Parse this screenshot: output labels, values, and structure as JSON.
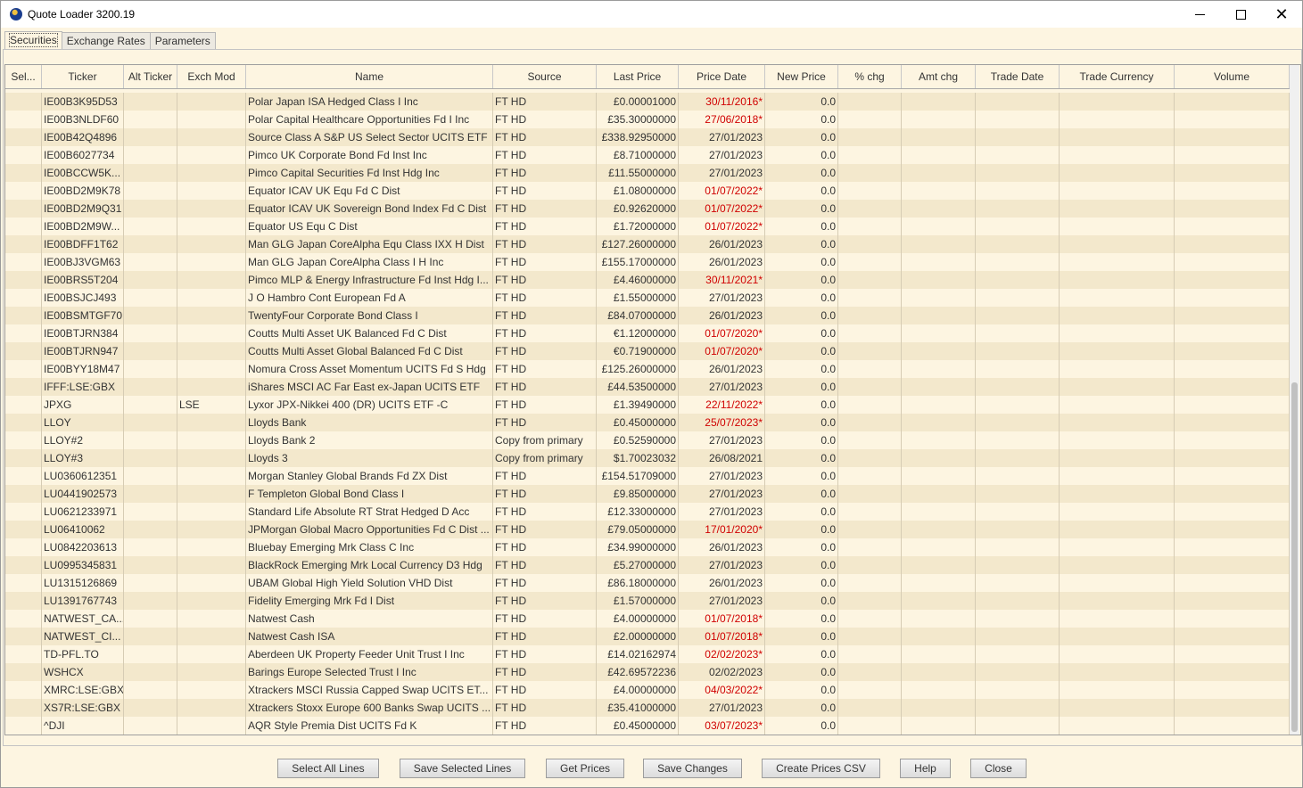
{
  "window": {
    "title": "Quote Loader 3200.19"
  },
  "tabs": [
    {
      "label": "Securities",
      "active": true
    },
    {
      "label": "Exchange Rates",
      "active": false
    },
    {
      "label": "Parameters",
      "active": false
    }
  ],
  "table": {
    "columns": [
      "Sel...",
      "Ticker",
      "Alt Ticker",
      "Exch Mod",
      "Name",
      "Source",
      "Last Price",
      "Price Date",
      "New Price",
      "% chg",
      "Amt chg",
      "Trade Date",
      "Trade Currency",
      "Volume"
    ],
    "rows": [
      {
        "ticker": "IE00B3K95D53",
        "alt": "",
        "exch": "",
        "name": "Polar Japan ISA Hedged Class I Inc",
        "source": "FT HD",
        "last_price": "£0.00001000",
        "price_date": "30/11/2016*",
        "stale": true,
        "new_price": "0.0"
      },
      {
        "ticker": "IE00B3NLDF60",
        "alt": "",
        "exch": "",
        "name": "Polar Capital Healthcare Opportunities Fd I Inc",
        "source": "FT HD",
        "last_price": "£35.30000000",
        "price_date": "27/06/2018*",
        "stale": true,
        "new_price": "0.0"
      },
      {
        "ticker": "IE00B42Q4896",
        "alt": "",
        "exch": "",
        "name": "Source Class A S&P US Select Sector UCITS ETF",
        "source": "FT HD",
        "last_price": "£338.92950000",
        "price_date": "27/01/2023",
        "stale": false,
        "new_price": "0.0"
      },
      {
        "ticker": "IE00B6027734",
        "alt": "",
        "exch": "",
        "name": "Pimco UK Corporate Bond Fd Inst Inc",
        "source": "FT HD",
        "last_price": "£8.71000000",
        "price_date": "27/01/2023",
        "stale": false,
        "new_price": "0.0"
      },
      {
        "ticker": "IE00BCCW5K...",
        "alt": "",
        "exch": "",
        "name": "Pimco Capital Securities Fd Inst Hdg Inc",
        "source": "FT HD",
        "last_price": "£11.55000000",
        "price_date": "27/01/2023",
        "stale": false,
        "new_price": "0.0"
      },
      {
        "ticker": "IE00BD2M9K78",
        "alt": "",
        "exch": "",
        "name": "Equator ICAV UK Equ Fd C Dist",
        "source": "FT HD",
        "last_price": "£1.08000000",
        "price_date": "01/07/2022*",
        "stale": true,
        "new_price": "0.0"
      },
      {
        "ticker": "IE00BD2M9Q31",
        "alt": "",
        "exch": "",
        "name": "Equator ICAV UK Sovereign Bond Index Fd C Dist",
        "source": "FT HD",
        "last_price": "£0.92620000",
        "price_date": "01/07/2022*",
        "stale": true,
        "new_price": "0.0"
      },
      {
        "ticker": "IE00BD2M9W...",
        "alt": "",
        "exch": "",
        "name": "Equator US Equ C Dist",
        "source": "FT HD",
        "last_price": "£1.72000000",
        "price_date": "01/07/2022*",
        "stale": true,
        "new_price": "0.0"
      },
      {
        "ticker": "IE00BDFF1T62",
        "alt": "",
        "exch": "",
        "name": "Man GLG Japan CoreAlpha Equ Class IXX H Dist",
        "source": "FT HD",
        "last_price": "£127.26000000",
        "price_date": "26/01/2023",
        "stale": false,
        "new_price": "0.0"
      },
      {
        "ticker": "IE00BJ3VGM63",
        "alt": "",
        "exch": "",
        "name": "Man GLG Japan CoreAlpha Class I H Inc",
        "source": "FT HD",
        "last_price": "£155.17000000",
        "price_date": "26/01/2023",
        "stale": false,
        "new_price": "0.0"
      },
      {
        "ticker": "IE00BRS5T204",
        "alt": "",
        "exch": "",
        "name": "Pimco MLP & Energy Infrastructure Fd Inst Hdg I...",
        "source": "FT HD",
        "last_price": "£4.46000000",
        "price_date": "30/11/2021*",
        "stale": true,
        "new_price": "0.0"
      },
      {
        "ticker": "IE00BSJCJ493",
        "alt": "",
        "exch": "",
        "name": "J O Hambro Cont European Fd A",
        "source": "FT HD",
        "last_price": "£1.55000000",
        "price_date": "27/01/2023",
        "stale": false,
        "new_price": "0.0"
      },
      {
        "ticker": "IE00BSMTGF70",
        "alt": "",
        "exch": "",
        "name": "TwentyFour Corporate Bond Class I",
        "source": "FT HD",
        "last_price": "£84.07000000",
        "price_date": "26/01/2023",
        "stale": false,
        "new_price": "0.0"
      },
      {
        "ticker": "IE00BTJRN384",
        "alt": "",
        "exch": "",
        "name": "Coutts Multi Asset UK Balanced Fd C Dist",
        "source": "FT HD",
        "last_price": "€1.12000000",
        "price_date": "01/07/2020*",
        "stale": true,
        "new_price": "0.0"
      },
      {
        "ticker": "IE00BTJRN947",
        "alt": "",
        "exch": "",
        "name": "Coutts Multi Asset Global Balanced Fd C Dist",
        "source": "FT HD",
        "last_price": "€0.71900000",
        "price_date": "01/07/2020*",
        "stale": true,
        "new_price": "0.0"
      },
      {
        "ticker": "IE00BYY18M47",
        "alt": "",
        "exch": "",
        "name": "Nomura Cross Asset Momentum UCITS Fd S Hdg",
        "source": "FT HD",
        "last_price": "£125.26000000",
        "price_date": "26/01/2023",
        "stale": false,
        "new_price": "0.0"
      },
      {
        "ticker": "IFFF:LSE:GBX",
        "alt": "",
        "exch": "",
        "name": "iShares MSCI AC Far East ex-Japan UCITS ETF",
        "source": "FT HD",
        "last_price": "£44.53500000",
        "price_date": "27/01/2023",
        "stale": false,
        "new_price": "0.0"
      },
      {
        "ticker": "JPXG",
        "alt": "",
        "exch": "LSE",
        "name": "Lyxor JPX-Nikkei 400 (DR) UCITS ETF -C",
        "source": "FT HD",
        "last_price": "£1.39490000",
        "price_date": "22/11/2022*",
        "stale": true,
        "new_price": "0.0"
      },
      {
        "ticker": "LLOY",
        "alt": "",
        "exch": "",
        "name": "Lloyds Bank",
        "source": "FT HD",
        "last_price": "£0.45000000",
        "price_date": "25/07/2023*",
        "stale": true,
        "new_price": "0.0"
      },
      {
        "ticker": "LLOY#2",
        "alt": "",
        "exch": "",
        "name": "Lloyds Bank 2",
        "source": "Copy from primary",
        "last_price": "£0.52590000",
        "price_date": "27/01/2023",
        "stale": false,
        "new_price": "0.0"
      },
      {
        "ticker": "LLOY#3",
        "alt": "",
        "exch": "",
        "name": "Lloyds 3",
        "source": "Copy from primary",
        "last_price": "$1.70023032",
        "price_date": "26/08/2021",
        "stale": false,
        "new_price": "0.0"
      },
      {
        "ticker": "LU0360612351",
        "alt": "",
        "exch": "",
        "name": "Morgan Stanley Global Brands Fd ZX Dist",
        "source": "FT HD",
        "last_price": "£154.51709000",
        "price_date": "27/01/2023",
        "stale": false,
        "new_price": "0.0"
      },
      {
        "ticker": "LU0441902573",
        "alt": "",
        "exch": "",
        "name": "F Templeton Global Bond Class I",
        "source": "FT HD",
        "last_price": "£9.85000000",
        "price_date": "27/01/2023",
        "stale": false,
        "new_price": "0.0"
      },
      {
        "ticker": "LU0621233971",
        "alt": "",
        "exch": "",
        "name": "Standard Life Absolute RT Strat Hedged D Acc",
        "source": "FT HD",
        "last_price": "£12.33000000",
        "price_date": "27/01/2023",
        "stale": false,
        "new_price": "0.0"
      },
      {
        "ticker": "LU06410062",
        "alt": "",
        "exch": "",
        "name": "JPMorgan Global Macro Opportunities Fd C Dist ...",
        "source": "FT HD",
        "last_price": "£79.05000000",
        "price_date": "17/01/2020*",
        "stale": true,
        "new_price": "0.0"
      },
      {
        "ticker": "LU0842203613",
        "alt": "",
        "exch": "",
        "name": "Bluebay Emerging Mrk Class C Inc",
        "source": "FT HD",
        "last_price": "£34.99000000",
        "price_date": "26/01/2023",
        "stale": false,
        "new_price": "0.0"
      },
      {
        "ticker": "LU0995345831",
        "alt": "",
        "exch": "",
        "name": "BlackRock Emerging Mrk Local Currency D3 Hdg",
        "source": "FT HD",
        "last_price": "£5.27000000",
        "price_date": "27/01/2023",
        "stale": false,
        "new_price": "0.0"
      },
      {
        "ticker": "LU1315126869",
        "alt": "",
        "exch": "",
        "name": "UBAM Global High Yield Solution VHD Dist",
        "source": "FT HD",
        "last_price": "£86.18000000",
        "price_date": "26/01/2023",
        "stale": false,
        "new_price": "0.0"
      },
      {
        "ticker": "LU1391767743",
        "alt": "",
        "exch": "",
        "name": "Fidelity Emerging Mrk Fd I Dist",
        "source": "FT HD",
        "last_price": "£1.57000000",
        "price_date": "27/01/2023",
        "stale": false,
        "new_price": "0.0"
      },
      {
        "ticker": "NATWEST_CA...",
        "alt": "",
        "exch": "",
        "name": "Natwest Cash",
        "source": "FT HD",
        "last_price": "£4.00000000",
        "price_date": "01/07/2018*",
        "stale": true,
        "new_price": "0.0"
      },
      {
        "ticker": "NATWEST_CI...",
        "alt": "",
        "exch": "",
        "name": "Natwest Cash ISA",
        "source": "FT HD",
        "last_price": "£2.00000000",
        "price_date": "01/07/2018*",
        "stale": true,
        "new_price": "0.0"
      },
      {
        "ticker": "TD-PFL.TO",
        "alt": "",
        "exch": "",
        "name": "Aberdeen UK Property Feeder Unit Trust I Inc",
        "source": "FT HD",
        "last_price": "£14.02162974",
        "price_date": "02/02/2023*",
        "stale": true,
        "new_price": "0.0"
      },
      {
        "ticker": "WSHCX",
        "alt": "",
        "exch": "",
        "name": "Barings Europe Selected Trust I Inc",
        "source": "FT HD",
        "last_price": "£42.69572236",
        "price_date": "02/02/2023",
        "stale": false,
        "new_price": "0.0"
      },
      {
        "ticker": "XMRC:LSE:GBX",
        "alt": "",
        "exch": "",
        "name": "Xtrackers MSCI Russia Capped Swap UCITS ET...",
        "source": "FT HD",
        "last_price": "£4.00000000",
        "price_date": "04/03/2022*",
        "stale": true,
        "new_price": "0.0"
      },
      {
        "ticker": "XS7R:LSE:GBX",
        "alt": "",
        "exch": "",
        "name": "Xtrackers Stoxx Europe 600 Banks Swap UCITS ...",
        "source": "FT HD",
        "last_price": "£35.41000000",
        "price_date": "27/01/2023",
        "stale": false,
        "new_price": "0.0"
      },
      {
        "ticker": "^DJI",
        "alt": "",
        "exch": "",
        "name": "AQR Style Premia Dist UCITS Fd K",
        "source": "FT HD",
        "last_price": "£0.45000000",
        "price_date": "03/07/2023*",
        "stale": true,
        "new_price": "0.0"
      }
    ]
  },
  "footer": {
    "select_all": "Select All Lines",
    "save_selected": "Save Selected Lines",
    "get_prices": "Get Prices",
    "save_changes": "Save Changes",
    "create_csv": "Create Prices CSV",
    "help": "Help",
    "close": "Close"
  },
  "colors": {
    "background": "#fdf5e1",
    "row_shade": "#f3e8cc",
    "stale_date": "#d00000"
  },
  "icons": [
    "app-globe-icon",
    "minimize-icon",
    "maximize-icon",
    "close-icon"
  ]
}
